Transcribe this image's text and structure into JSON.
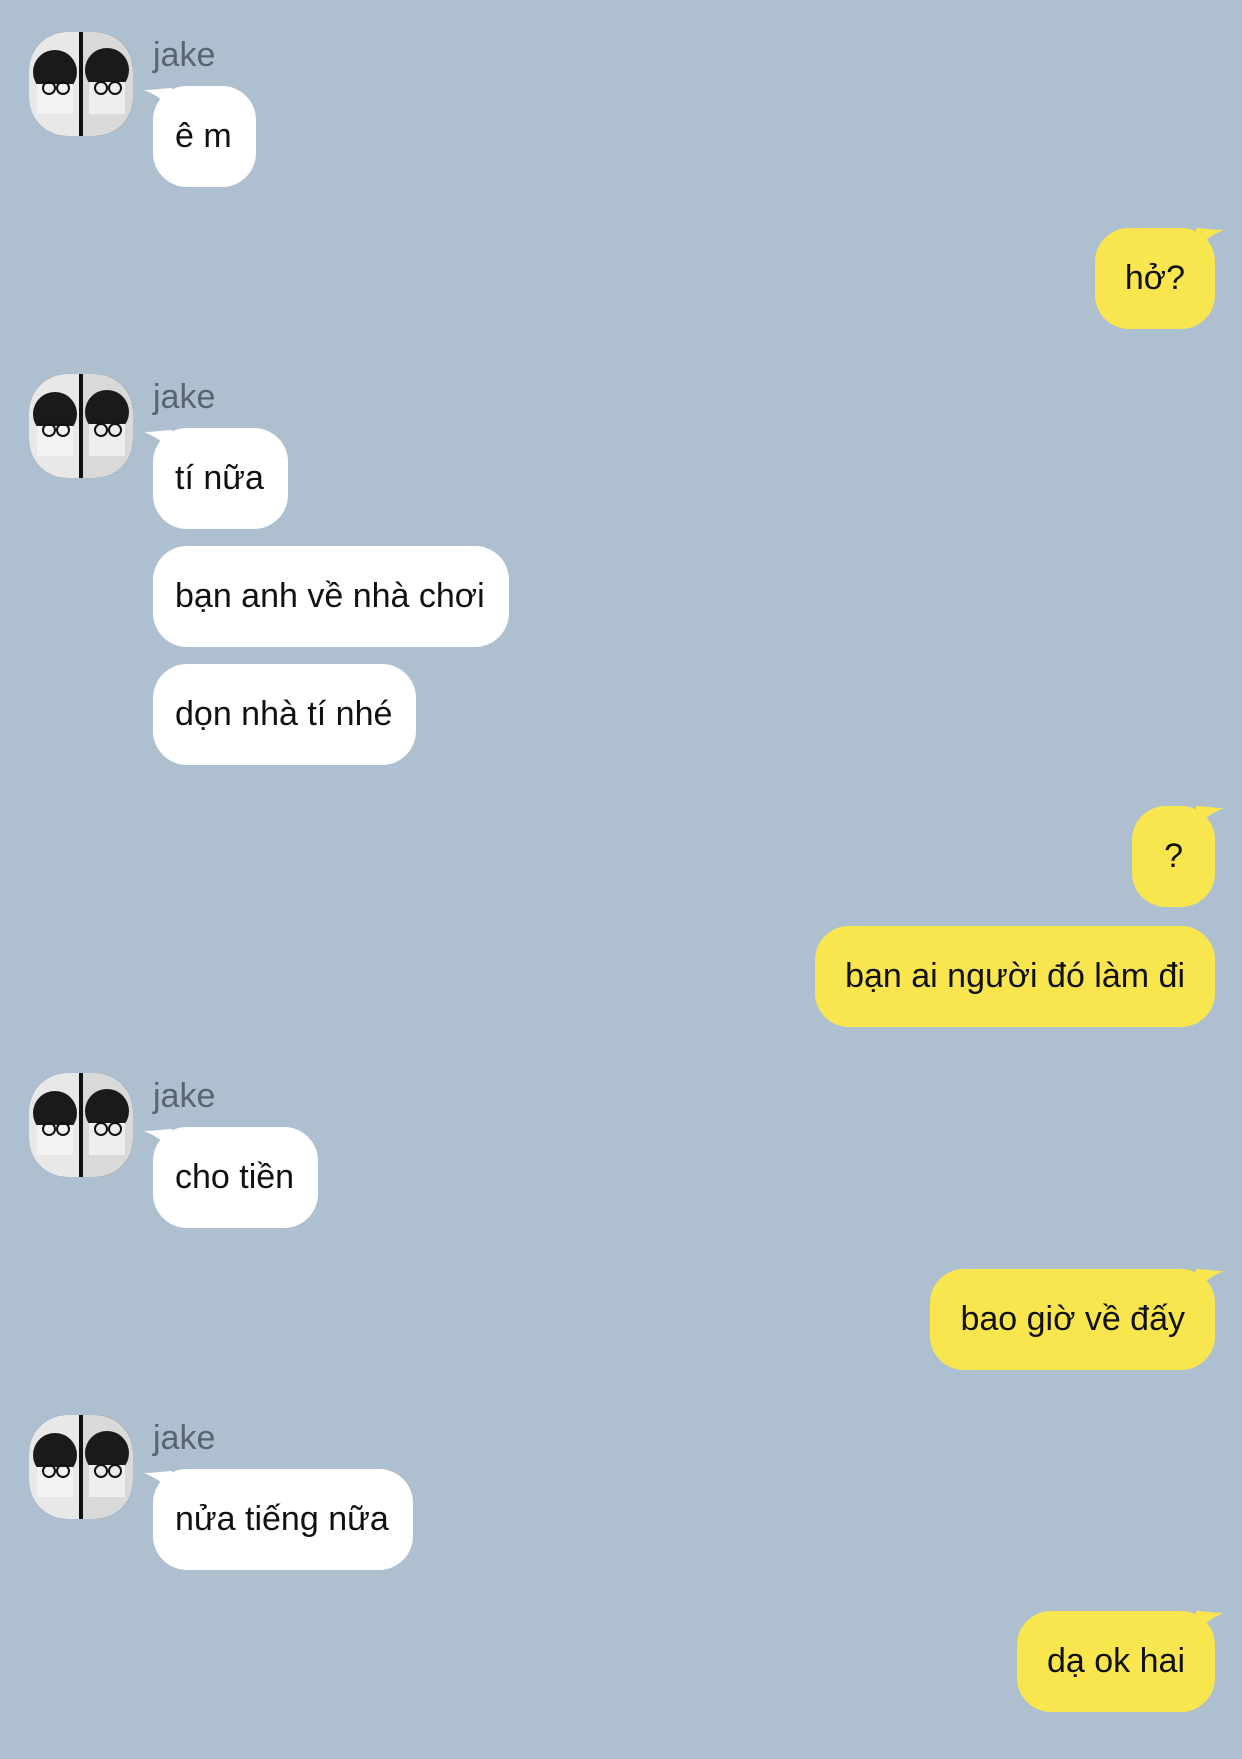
{
  "colors": {
    "background": "#aec0cf",
    "incoming_bubble": "#ffffff",
    "outgoing_bubble": "#f9e64f",
    "sender_name": "#5a6470"
  },
  "messages": [
    {
      "id": "g1",
      "sender": "jake",
      "texts": [
        "ê m"
      ]
    },
    {
      "id": "o1",
      "texts": [
        "hở?"
      ]
    },
    {
      "id": "g2",
      "sender": "jake",
      "texts": [
        "tí nữa",
        "bạn anh về nhà chơi",
        "dọn nhà tí nhé"
      ]
    },
    {
      "id": "o2",
      "texts": [
        "?",
        "bạn ai người đó làm đi"
      ]
    },
    {
      "id": "g3",
      "sender": "jake",
      "texts": [
        "cho tiền"
      ]
    },
    {
      "id": "o3",
      "texts": [
        "bao giờ về đấy"
      ]
    },
    {
      "id": "g4",
      "sender": "jake",
      "texts": [
        "nửa tiếng nữa"
      ]
    },
    {
      "id": "o4",
      "texts": [
        "dạ ok hai"
      ]
    }
  ],
  "avatar_icon": "profile-photo"
}
